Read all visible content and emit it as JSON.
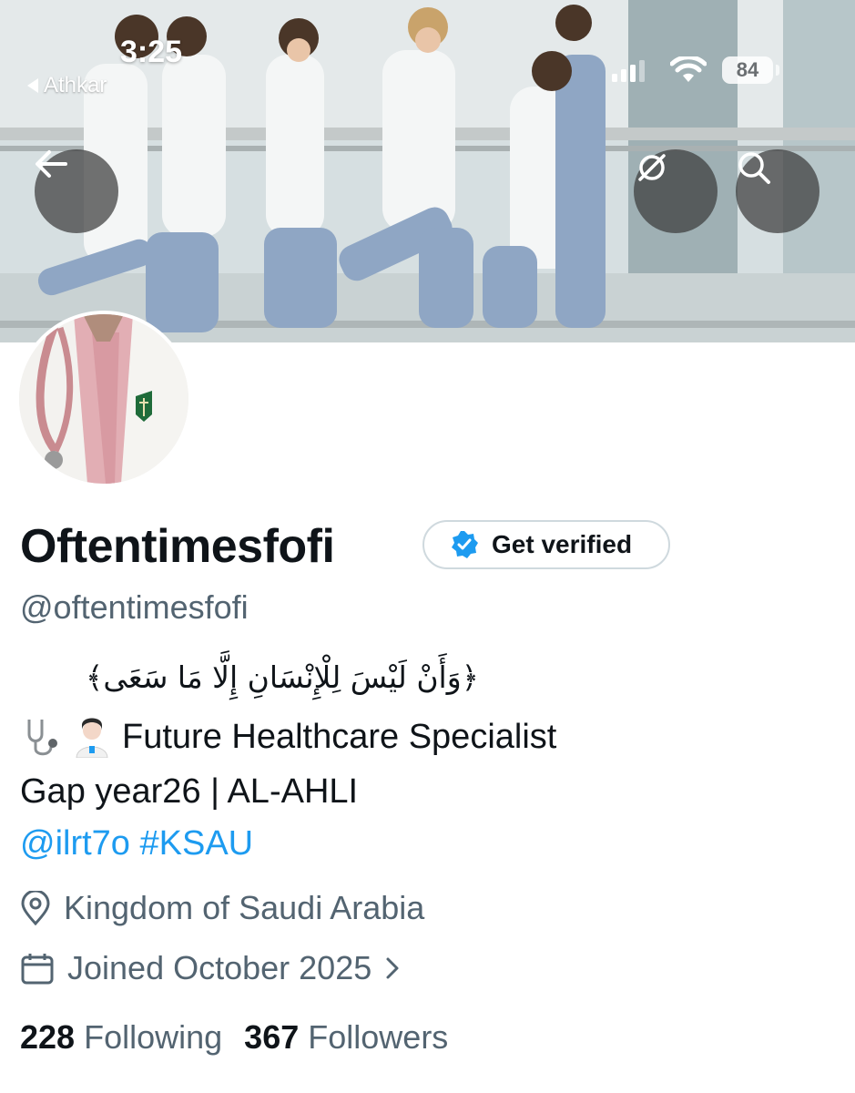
{
  "status_bar": {
    "time": "3:25",
    "back_app": "Athkar",
    "battery": "84"
  },
  "profile": {
    "display_name": "Oftentimesfofi",
    "get_verified_label": "Get verified",
    "handle": "@oftentimesfofi",
    "bio": {
      "arabic_verse": "﴿وَأَنْ لَيْسَ لِلْإِنْسَانِ إِلَّا مَا سَعَى﴾",
      "line2": "Future Healthcare Specialist",
      "line3": "Gap year26 | AL-AHLI",
      "mention": "@ilrt7o",
      "hashtag": "#KSAU"
    },
    "location": "Kingdom of Saudi Arabia",
    "joined": "Joined October 2025",
    "following_count": "228",
    "following_label": "Following",
    "followers_count": "367",
    "followers_label": "Followers"
  },
  "icons": {
    "back": "arrow-left-icon",
    "grok": "grok-icon",
    "search": "search-icon",
    "location": "location-pin-icon",
    "calendar": "calendar-icon",
    "verified": "verified-badge-icon"
  },
  "colors": {
    "accent": "#1d9bf0",
    "secondary_text": "#536471",
    "primary_text": "#0f1419"
  }
}
